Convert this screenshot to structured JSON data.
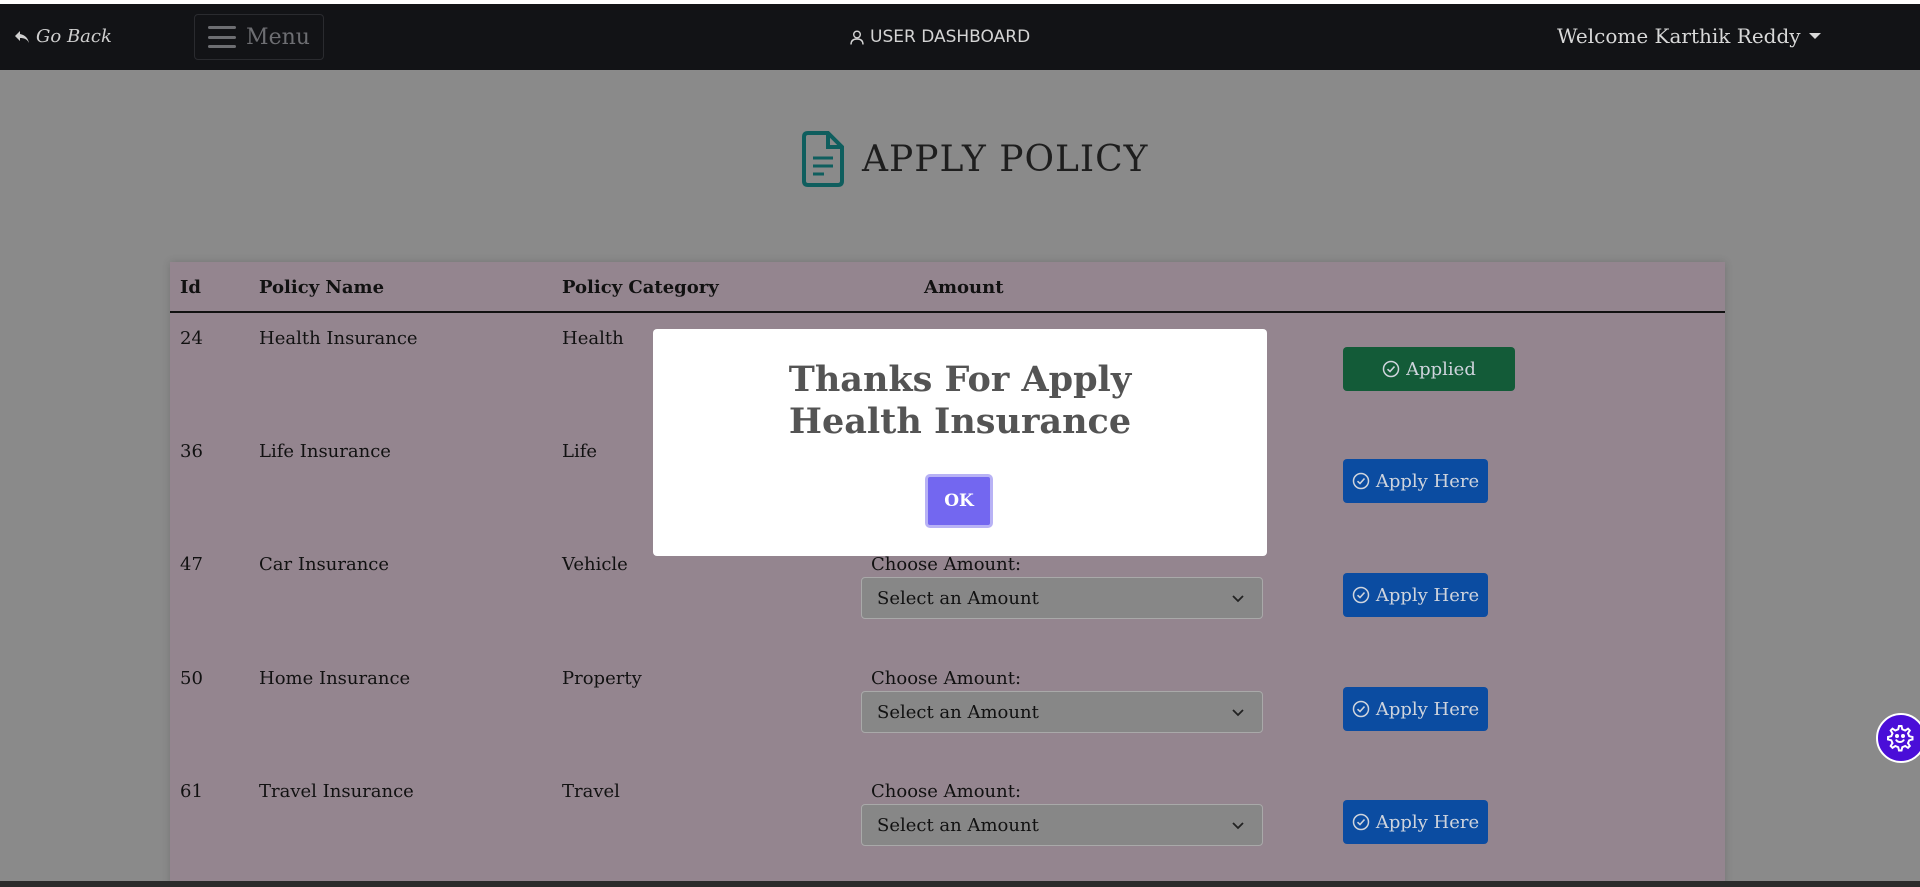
{
  "navbar": {
    "go_back": "Go Back",
    "menu": "Menu",
    "dashboard": "USER DASHBOARD",
    "welcome": "Welcome Karthik Reddy"
  },
  "page": {
    "title": "APPLY POLICY"
  },
  "table": {
    "headers": [
      "Id",
      "Policy Name",
      "Policy Category",
      "Amount"
    ],
    "rows": [
      {
        "id": "24",
        "name": "Health Insurance",
        "category": "Health",
        "action": "Applied"
      },
      {
        "id": "36",
        "name": "Life Insurance",
        "category": "Life",
        "action": "Apply Here"
      },
      {
        "id": "47",
        "name": "Car Insurance",
        "category": "Vehicle",
        "choose_label": "Choose Amount:",
        "select_placeholder": "Select an Amount",
        "action": "Apply Here"
      },
      {
        "id": "50",
        "name": "Home Insurance",
        "category": "Property",
        "choose_label": "Choose Amount:",
        "select_placeholder": "Select an Amount",
        "action": "Apply Here"
      },
      {
        "id": "61",
        "name": "Travel Insurance",
        "category": "Travel",
        "choose_label": "Choose Amount:",
        "select_placeholder": "Select an Amount",
        "action": "Apply Here"
      }
    ]
  },
  "modal": {
    "title_line1": "Thanks For Apply",
    "title_line2": "Health Insurance",
    "ok": "OK"
  },
  "icons": {
    "go_back": "reply-arrow-icon",
    "menu": "hamburger-icon",
    "dashboard": "user-icon",
    "heading": "document-icon",
    "check": "check-circle-icon",
    "select": "chevron-down-icon",
    "settings": "gear-icon"
  },
  "colors": {
    "applied": "#135b38",
    "apply": "#0b4ca1",
    "ok_button": "#7367f0",
    "settings_fab": "#4a0ed8",
    "heading_icon": "#0f5e5e"
  }
}
